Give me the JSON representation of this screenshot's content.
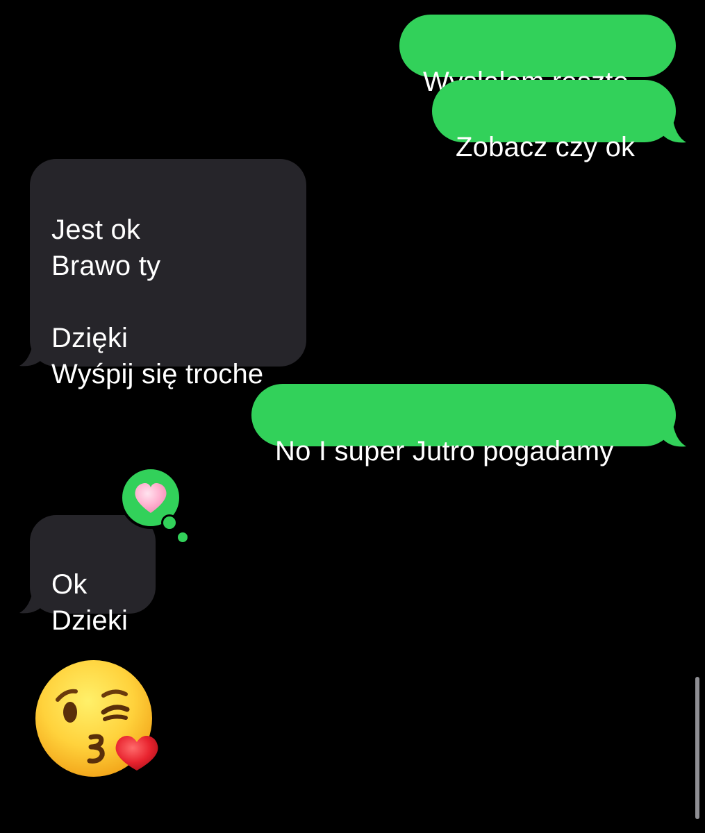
{
  "conversation": {
    "messages": [
      {
        "direction": "sent",
        "text": "Wyslalem reszte"
      },
      {
        "direction": "sent",
        "text": "Zobacz czy ok"
      },
      {
        "direction": "received",
        "text": "Jest ok\nBrawo ty\n\nDzięki\nWyśpij się troche"
      },
      {
        "direction": "sent",
        "text": "No I super Jutro pogadamy"
      },
      {
        "direction": "received",
        "text": "Ok\nDzieki",
        "reaction": "pink-heart-icon"
      },
      {
        "direction": "received",
        "emoji": "kissing-face-with-heart-icon"
      }
    ]
  },
  "colors": {
    "background": "#000000",
    "sent_bubble": "#32d15a",
    "received_bubble": "#26252a",
    "text": "#ffffff"
  }
}
